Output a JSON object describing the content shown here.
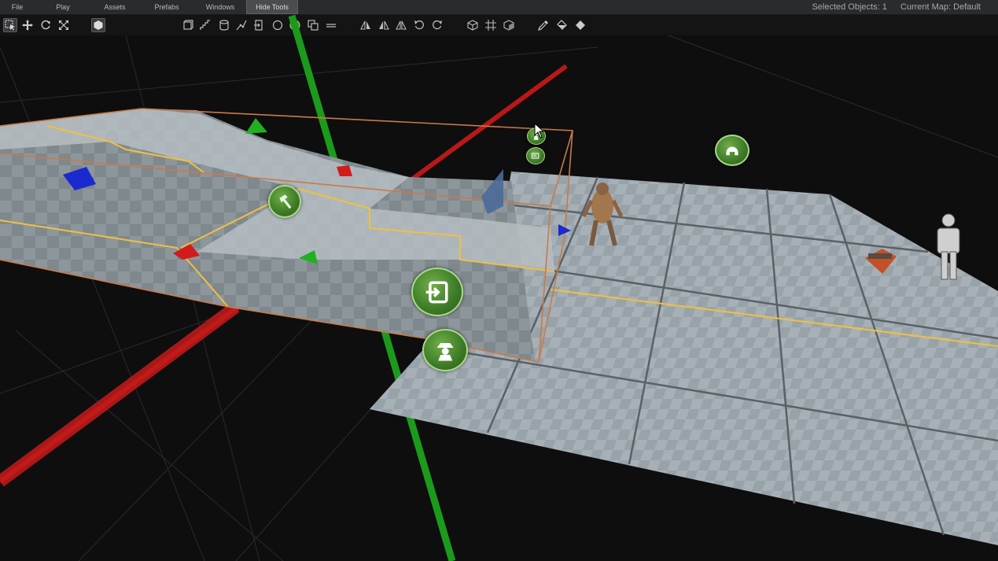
{
  "menu": {
    "items": [
      {
        "label": "File"
      },
      {
        "label": "Play"
      },
      {
        "label": "Assets"
      },
      {
        "label": "Prefabs"
      },
      {
        "label": "Windows"
      },
      {
        "label": "Hide Tools"
      }
    ]
  },
  "status": {
    "selected_objects": "Selected Objects: 1",
    "current_map": "Current Map: Default"
  },
  "colors": {
    "axis_x": "#c41a1a",
    "axis_y": "#1fa51f",
    "marker_green": "#4a8a2e",
    "selection_outline": "#c87a4a",
    "highlight_edge": "#f0c040"
  },
  "toolbar": {
    "transform_tools": [
      "select-icon",
      "move-icon",
      "rotate-icon",
      "scale-icon",
      "object-mode-icon"
    ],
    "create_tools": [
      "box-icon",
      "stairs-icon",
      "cylinder-icon",
      "path-icon",
      "door-icon",
      "sphere-icon",
      "face-icon",
      "copy-icon",
      "plane-icon"
    ],
    "mirror_tools": [
      "mirror-x-icon",
      "mirror-y-icon",
      "mirror-z-icon",
      "undo-icon",
      "redo-icon"
    ],
    "view_tools": [
      "cube-view-icon",
      "grid-icon",
      "cube-solid-icon"
    ],
    "paint_tools": [
      "eyedropper-icon",
      "paint-bucket-icon",
      "fill-icon"
    ]
  },
  "viewport": {
    "markers": [
      "hammer-icon",
      "exit-icon",
      "spy-icon",
      "helmet-icon",
      "small-person-icon",
      "small-ad-icon"
    ]
  }
}
